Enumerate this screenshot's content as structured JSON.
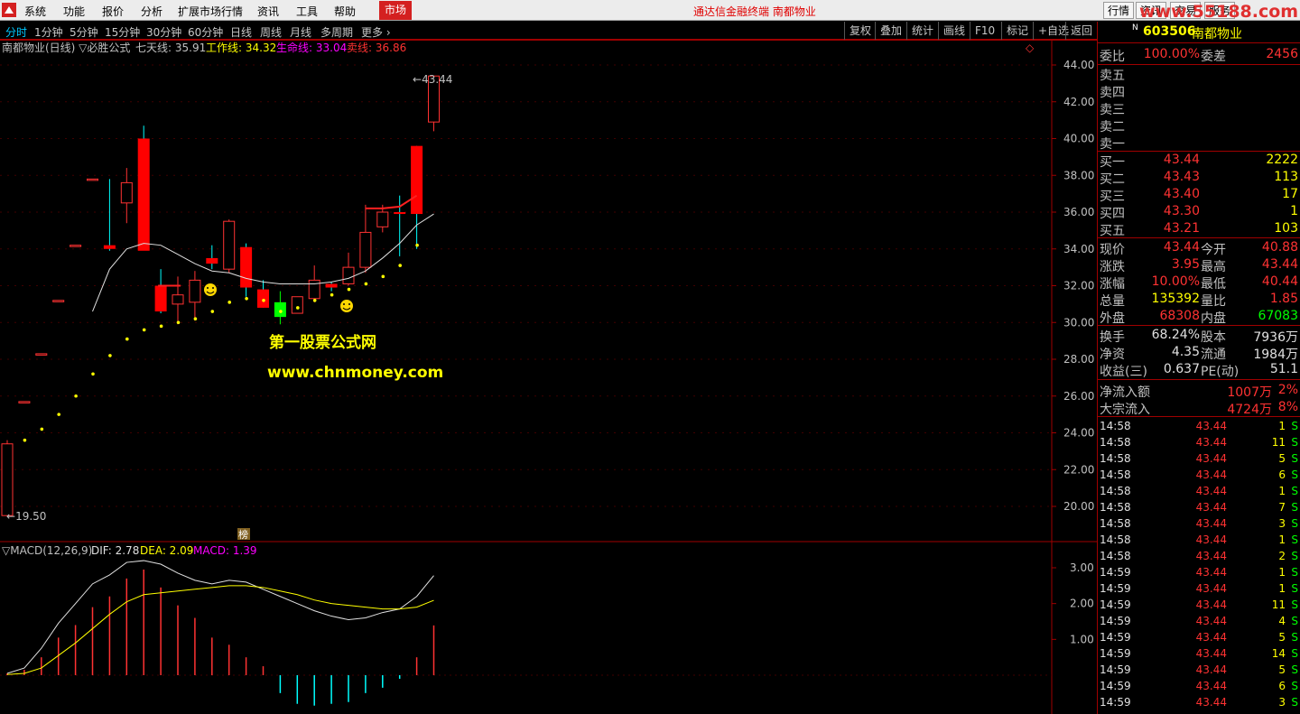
{
  "menubar": {
    "items": [
      "系统",
      "功能",
      "报价",
      "分析",
      "扩展市场行情",
      "资讯",
      "工具",
      "帮助"
    ],
    "market_tab": "市场",
    "app_title": "通达信金融终端  南都物业",
    "right_buttons": [
      "行情",
      "资讯",
      "交易",
      "服务"
    ],
    "watermark": "www.55188.com",
    "colors": {
      "accent_red": "#d42020",
      "menubar_bg": "#ececec"
    }
  },
  "periodbar": {
    "periods": [
      "分时",
      "1分钟",
      "5分钟",
      "15分钟",
      "30分钟",
      "60分钟",
      "日线",
      "周线",
      "月线",
      "多周期",
      "更多 ›"
    ],
    "active_period": "分时",
    "tools": [
      "复权",
      "叠加",
      "统计",
      "画线",
      "F10",
      "标记",
      "+自选",
      "返回"
    ]
  },
  "main_chart": {
    "title": "南都物业(日线) ▽必胜公式",
    "ind_seven_label": "七天线: 35.91",
    "ind_work_label": "工作线: 34.32",
    "ind_life_label": "生命线: 33.04",
    "ind_sell_label": "卖线: 36.86",
    "high_marker": "43.44",
    "low_marker": "19.50",
    "bang_label": "榜",
    "watermark_cn": "第一股票公式网",
    "watermark_url": "www.chnmoney.com",
    "y_ticks": [
      "44.00",
      "42.00",
      "40.00",
      "38.00",
      "36.00",
      "34.00",
      "32.00",
      "30.00",
      "28.00",
      "26.00",
      "24.00",
      "22.00",
      "20.00"
    ]
  },
  "macd": {
    "title": "▽MACD(12,26,9)",
    "dif_label": "DIF: 2.78",
    "dea_label": "DEA: 2.09",
    "macd_label": "MACD: 1.39",
    "y_ticks": [
      "3.00",
      "2.00",
      "1.00"
    ]
  },
  "chart_data": {
    "type": "candlestick",
    "candles": [
      {
        "o": 19.5,
        "h": 23.6,
        "l": 19.5,
        "c": 23.4
      },
      {
        "o": 25.7,
        "h": 25.7,
        "l": 25.7,
        "c": 25.7
      },
      {
        "o": 28.3,
        "h": 28.3,
        "l": 28.3,
        "c": 28.3
      },
      {
        "o": 31.2,
        "h": 31.2,
        "l": 31.2,
        "c": 31.2
      },
      {
        "o": 34.2,
        "h": 34.2,
        "l": 34.2,
        "c": 34.2
      },
      {
        "o": 37.8,
        "h": 37.8,
        "l": 37.8,
        "c": 37.8
      },
      {
        "o": 34.2,
        "h": 37.8,
        "l": 33.9,
        "c": 34.0
      },
      {
        "o": 36.5,
        "h": 38.4,
        "l": 35.4,
        "c": 37.6
      },
      {
        "o": 40.0,
        "h": 40.7,
        "l": 34.0,
        "c": 33.9
      },
      {
        "o": 32.0,
        "h": 32.9,
        "l": 30.5,
        "c": 30.6
      },
      {
        "o": 31.0,
        "h": 32.5,
        "l": 29.9,
        "c": 31.5
      },
      {
        "o": 31.1,
        "h": 32.8,
        "l": 30.1,
        "c": 32.3
      },
      {
        "o": 33.5,
        "h": 34.2,
        "l": 32.9,
        "c": 33.2
      },
      {
        "o": 32.9,
        "h": 35.6,
        "l": 32.7,
        "c": 35.5
      },
      {
        "o": 34.1,
        "h": 34.3,
        "l": 31.4,
        "c": 31.9
      },
      {
        "o": 31.8,
        "h": 32.3,
        "l": 30.8,
        "c": 30.8
      },
      {
        "o": 30.3,
        "h": 31.7,
        "l": 29.9,
        "c": 31.1
      },
      {
        "o": 30.5,
        "h": 31.4,
        "l": 30.5,
        "c": 31.4
      },
      {
        "o": 31.3,
        "h": 33.1,
        "l": 31.1,
        "c": 32.3
      },
      {
        "o": 32.1,
        "h": 32.2,
        "l": 31.7,
        "c": 31.9
      },
      {
        "o": 32.1,
        "h": 33.8,
        "l": 32.0,
        "c": 33.0
      },
      {
        "o": 33.0,
        "h": 36.4,
        "l": 32.7,
        "c": 34.9
      },
      {
        "o": 35.2,
        "h": 36.4,
        "l": 34.9,
        "c": 36.0
      },
      {
        "o": 36.0,
        "h": 36.9,
        "l": 33.6,
        "c": 35.9
      },
      {
        "o": 39.6,
        "h": 39.6,
        "l": 34.0,
        "c": 35.9
      },
      {
        "o": 40.9,
        "h": 43.4,
        "l": 40.4,
        "c": 43.4
      }
    ],
    "ylim": [
      18.0,
      45.5
    ],
    "macd_ylim": [
      -0.9,
      3.4
    ],
    "macd_hist": [
      0.05,
      0.15,
      0.5,
      1.05,
      1.4,
      1.9,
      2.2,
      2.7,
      2.95,
      2.45,
      1.95,
      1.6,
      1.05,
      0.85,
      0.5,
      0.25,
      -0.5,
      -0.8,
      -0.85,
      -0.8,
      -0.75,
      -0.5,
      -0.35,
      -0.1,
      0.5,
      1.39
    ],
    "dif": [
      0.05,
      0.2,
      0.75,
      1.45,
      2.0,
      2.55,
      2.8,
      3.15,
      3.2,
      3.1,
      2.85,
      2.65,
      2.55,
      2.65,
      2.6,
      2.4,
      2.2,
      2.0,
      1.8,
      1.65,
      1.55,
      1.6,
      1.75,
      1.85,
      2.2,
      2.78
    ],
    "dea": [
      0.02,
      0.05,
      0.2,
      0.55,
      0.9,
      1.3,
      1.7,
      2.05,
      2.25,
      2.3,
      2.35,
      2.4,
      2.45,
      2.5,
      2.5,
      2.45,
      2.35,
      2.25,
      2.1,
      2.0,
      1.95,
      1.9,
      1.85,
      1.85,
      1.9,
      2.09
    ]
  },
  "quote_panel": {
    "stock_code": "603506",
    "stock_name": "南都物业",
    "badge": "N",
    "weibi": {
      "label": "委比",
      "value": "100.00%",
      "label2": "委差",
      "value2": "2456"
    },
    "asks": [
      {
        "label": "卖五",
        "price": "",
        "vol": ""
      },
      {
        "label": "卖四",
        "price": "",
        "vol": ""
      },
      {
        "label": "卖三",
        "price": "",
        "vol": ""
      },
      {
        "label": "卖二",
        "price": "",
        "vol": ""
      },
      {
        "label": "卖一",
        "price": "",
        "vol": ""
      }
    ],
    "bids": [
      {
        "label": "买一",
        "price": "43.44",
        "vol": "2222"
      },
      {
        "label": "买二",
        "price": "43.43",
        "vol": "113"
      },
      {
        "label": "买三",
        "price": "43.40",
        "vol": "17"
      },
      {
        "label": "买四",
        "price": "43.30",
        "vol": "1"
      },
      {
        "label": "买五",
        "price": "43.21",
        "vol": "103"
      }
    ],
    "stats1": [
      {
        "l1": "现价",
        "v1": "43.44",
        "l2": "今开",
        "v2": "40.88"
      },
      {
        "l1": "涨跌",
        "v1": "3.95",
        "l2": "最高",
        "v2": "43.44"
      },
      {
        "l1": "涨幅",
        "v1": "10.00%",
        "l2": "最低",
        "v2": "40.44"
      },
      {
        "l1": "总量",
        "v1": "135392",
        "l2": "量比",
        "v2": "1.85"
      },
      {
        "l1": "外盘",
        "v1": "68308",
        "l2": "内盘",
        "v2": "67083"
      }
    ],
    "stats2": [
      {
        "l1": "换手",
        "v1": "68.24%",
        "l2": "股本",
        "v2": "7936万"
      },
      {
        "l1": "净资",
        "v1": "4.35",
        "l2": "流通",
        "v2": "1984万"
      },
      {
        "l1": "收益(三)",
        "v1": "0.637",
        "l2": "PE(动)",
        "v2": "51.1"
      }
    ],
    "flows": [
      {
        "label": "净流入额",
        "value": "1007万",
        "pct": "2%"
      },
      {
        "label": "大宗流入",
        "value": "4724万",
        "pct": "8%"
      }
    ],
    "ticks": [
      {
        "t": "14:58",
        "p": "43.44",
        "v": "1",
        "s": "S"
      },
      {
        "t": "14:58",
        "p": "43.44",
        "v": "11",
        "s": "S"
      },
      {
        "t": "14:58",
        "p": "43.44",
        "v": "5",
        "s": "S"
      },
      {
        "t": "14:58",
        "p": "43.44",
        "v": "6",
        "s": "S"
      },
      {
        "t": "14:58",
        "p": "43.44",
        "v": "1",
        "s": "S"
      },
      {
        "t": "14:58",
        "p": "43.44",
        "v": "7",
        "s": "S"
      },
      {
        "t": "14:58",
        "p": "43.44",
        "v": "3",
        "s": "S"
      },
      {
        "t": "14:58",
        "p": "43.44",
        "v": "1",
        "s": "S"
      },
      {
        "t": "14:58",
        "p": "43.44",
        "v": "2",
        "s": "S"
      },
      {
        "t": "14:59",
        "p": "43.44",
        "v": "1",
        "s": "S"
      },
      {
        "t": "14:59",
        "p": "43.44",
        "v": "1",
        "s": "S"
      },
      {
        "t": "14:59",
        "p": "43.44",
        "v": "11",
        "s": "S"
      },
      {
        "t": "14:59",
        "p": "43.44",
        "v": "4",
        "s": "S"
      },
      {
        "t": "14:59",
        "p": "43.44",
        "v": "5",
        "s": "S"
      },
      {
        "t": "14:59",
        "p": "43.44",
        "v": "14",
        "s": "S"
      },
      {
        "t": "14:59",
        "p": "43.44",
        "v": "5",
        "s": "S"
      },
      {
        "t": "14:59",
        "p": "43.44",
        "v": "6",
        "s": "S"
      },
      {
        "t": "14:59",
        "p": "43.44",
        "v": "3",
        "s": "S"
      }
    ]
  }
}
